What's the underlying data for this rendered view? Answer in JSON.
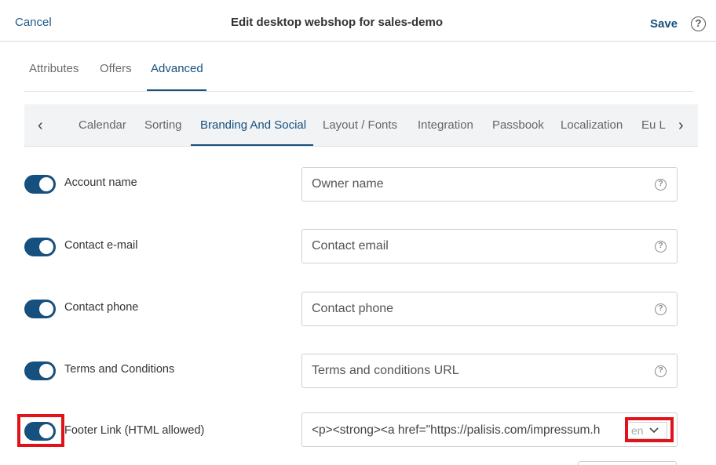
{
  "header": {
    "cancel_label": "Cancel",
    "title": "Edit desktop webshop for sales-demo",
    "save_label": "Save",
    "help_glyph": "?"
  },
  "tabs": [
    {
      "label": "Attributes",
      "active": false
    },
    {
      "label": "Offers",
      "active": false
    },
    {
      "label": "Advanced",
      "active": true
    }
  ],
  "subtabs": {
    "prev_glyph": "‹",
    "next_glyph": "›",
    "items": [
      {
        "label": "Calendar",
        "active": false
      },
      {
        "label": "Sorting",
        "active": false
      },
      {
        "label": "Branding And Social",
        "active": true
      },
      {
        "label": "Layout / Fonts",
        "active": false
      },
      {
        "label": "Integration",
        "active": false
      },
      {
        "label": "Passbook",
        "active": false
      },
      {
        "label": "Localization",
        "active": false
      },
      {
        "label": "Eu L",
        "active": false
      }
    ]
  },
  "rows": [
    {
      "label": "Account name",
      "enabled": true,
      "placeholder": "Owner name",
      "help_glyph": "?"
    },
    {
      "label": "Contact e-mail",
      "enabled": true,
      "placeholder": "Contact email",
      "help_glyph": "?"
    },
    {
      "label": "Contact phone",
      "enabled": true,
      "placeholder": "Contact phone",
      "help_glyph": "?"
    },
    {
      "label": "Terms and Conditions",
      "enabled": true,
      "placeholder": "Terms and conditions URL",
      "help_glyph": "?"
    }
  ],
  "footer_row": {
    "label": "Footer Link (HTML allowed)",
    "enabled": true,
    "value": "<p><strong><a href=\"https://palisis.com/impressum.h",
    "language": "en"
  },
  "colors": {
    "accent": "#16507e",
    "highlight": "#e0131a"
  },
  "icons": {
    "help": "question-circle-icon",
    "chevron_left": "chevron-left-icon",
    "chevron_right": "chevron-right-icon",
    "dropdown": "chevron-down-icon"
  }
}
